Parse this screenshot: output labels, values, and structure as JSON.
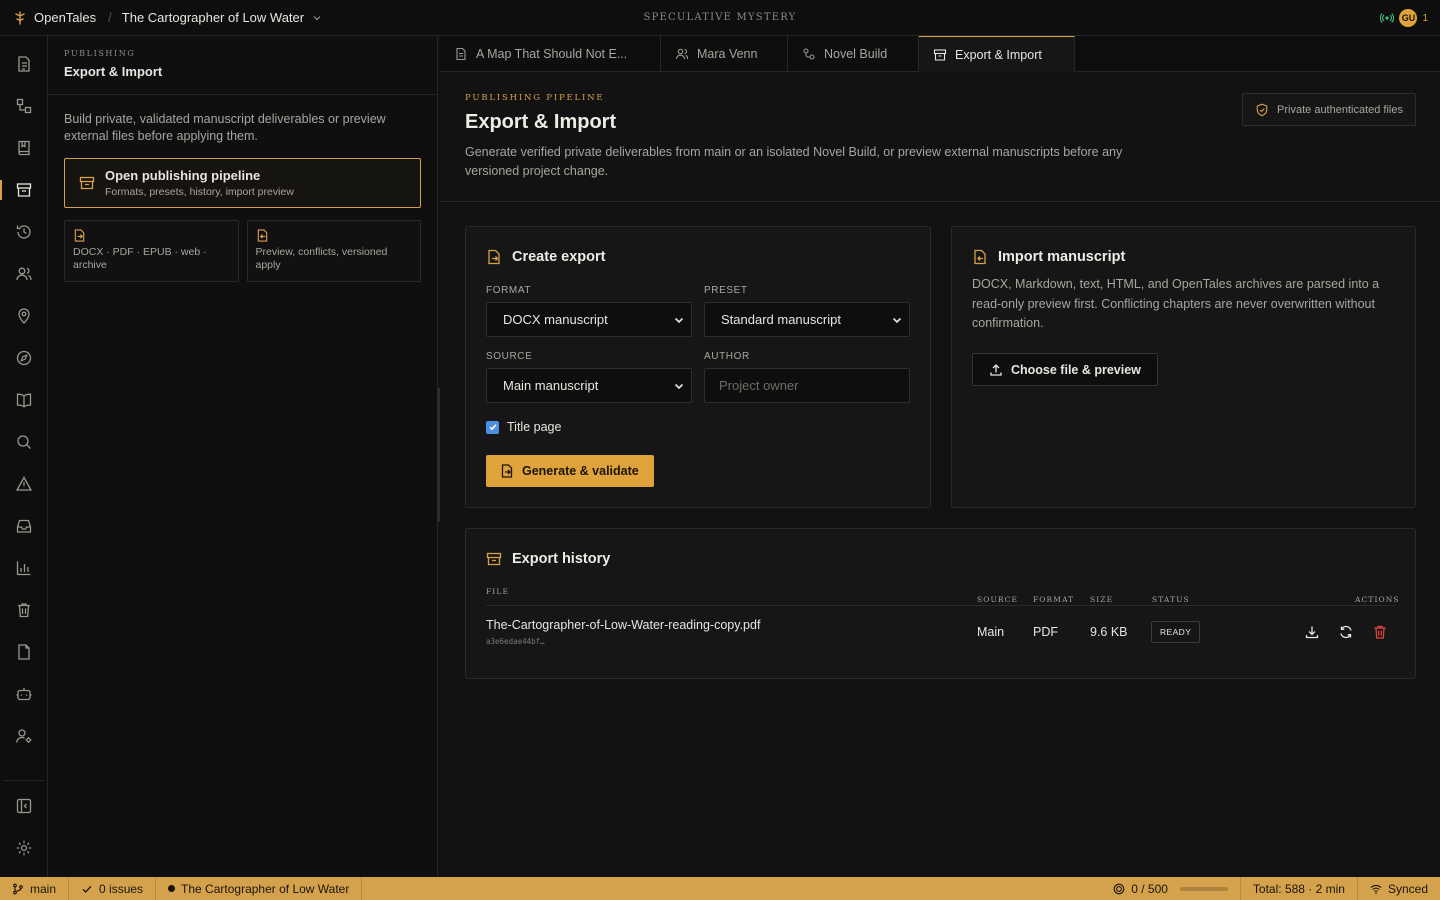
{
  "app": {
    "name": "OpenTales"
  },
  "project": {
    "title": "The Cartographer of Low Water",
    "genre": "SPECULATIVE MYSTERY"
  },
  "presence": {
    "initials": "GU",
    "count": "1"
  },
  "sidepanel": {
    "eyebrow": "PUBLISHING",
    "title": "Export & Import",
    "description": "Build private, validated manuscript deliverables or preview external files before applying them.",
    "pipeline_card": {
      "title": "Open publishing pipeline",
      "subtitle": "Formats, presets, history, import preview"
    },
    "mini_cards": [
      {
        "text": "DOCX · PDF · EPUB · web · archive"
      },
      {
        "text": "Preview, conflicts, versioned apply"
      }
    ]
  },
  "tabs": [
    {
      "label": "A Map That Should Not E..."
    },
    {
      "label": "Mara Venn"
    },
    {
      "label": "Novel Build"
    },
    {
      "label": "Export & Import"
    }
  ],
  "page": {
    "eyebrow": "PUBLISHING PIPELINE",
    "title": "Export & Import",
    "subtitle": "Generate verified private deliverables from main or an isolated Novel Build, or preview external manuscripts before any versioned project change.",
    "badge": "Private authenticated files"
  },
  "create_export": {
    "title": "Create export",
    "format_label": "FORMAT",
    "format_value": "DOCX manuscript",
    "preset_label": "PRESET",
    "preset_value": "Standard manuscript",
    "source_label": "SOURCE",
    "source_value": "Main manuscript",
    "author_label": "AUTHOR",
    "author_placeholder": "Project owner",
    "title_page_label": "Title page",
    "generate_button": "Generate & validate"
  },
  "import_manuscript": {
    "title": "Import manuscript",
    "description": "DOCX, Markdown, text, HTML, and OpenTales archives are parsed into a read-only preview first. Conflicting chapters are never overwritten without confirmation.",
    "button": "Choose file & preview"
  },
  "history": {
    "title": "Export history",
    "columns": {
      "file": "FILE",
      "source": "SOURCE",
      "format": "FORMAT",
      "size": "SIZE",
      "status": "STATUS",
      "actions": "ACTIONS"
    },
    "rows": [
      {
        "file": "The-Cartographer-of-Low-Water-reading-copy.pdf",
        "hash": "a3e6edae44bf…",
        "source": "Main",
        "format": "PDF",
        "size": "9.6 KB",
        "status": "READY"
      }
    ]
  },
  "statusbar": {
    "branch": "main",
    "issues": "0 issues",
    "project": "The Cartographer of Low Water",
    "goal": "0 / 500",
    "goal_progress": 0,
    "total": "Total: 588 · 2 min",
    "sync": "Synced"
  },
  "colors": {
    "accent": "#d8a04a",
    "background": "#121212",
    "statusbar": "#d4a24c",
    "danger": "#e0453c",
    "online": "#3fbf7f"
  }
}
